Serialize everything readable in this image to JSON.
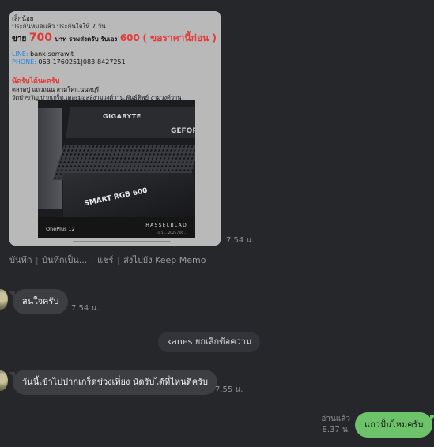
{
  "image_message": {
    "ad_lines": {
      "line1": "เล็กน้อย",
      "line2": "ประกันหมดแล้ว ประกันใจให้ 7 วัน",
      "price_prefix": "ขาย",
      "price_main": "700",
      "price_mid": "บาท รวมส่งครับ รับเอง",
      "price_pickup": "600",
      "price_note": "( ขอราคานี้ก่อน )",
      "line_label": "LINE:",
      "line_value": "bank-sorrawit",
      "phone_label": "PHONE:",
      "phone_value": "063-1760251|083-8427251",
      "meet_title": "นัดรับได้นะครับ",
      "address1": "ตลาดบู่ แถวถนน สามโคก,นนทบุรี",
      "address2": "วัดบัวขวัญ,ปากเกร็ด,เดอะมอลล์งามวงศ์วาน,พันธุ์ทิพย์ งามวงศ์วาน"
    },
    "photo": {
      "gpu_brand": "GIGABYTE",
      "gpu_brand2": "GEFOR",
      "psu_label": "SMART RGB 600",
      "watermark_device": "OnePlus 12",
      "watermark_brand": "HASSELBLAD",
      "watermark_sub": "⊙ 5 ... 2025 / 06 ..."
    },
    "time": "7.54 น."
  },
  "actions": {
    "save": "บันทึก",
    "save_as": "บันทึกเป็น...",
    "share": "แชร์",
    "keep": "ส่งไปยัง Keep Memo"
  },
  "messages": [
    {
      "from": "other",
      "text": "สนใจครับ",
      "time": "7.54 น."
    },
    {
      "from": "system",
      "text": "kanes ยกเลิกข้อความ"
    },
    {
      "from": "other",
      "text": "วันนี้เข้าไปปากเกร็ดช่วงเที่ยง นัดรับได้ที่ไหนดีครับ",
      "time": "7.55 น."
    },
    {
      "from": "me",
      "text": "แถวปั้มไหมครับ",
      "read": "อ่านแล้ว",
      "time": "8.37 น."
    }
  ],
  "colors": {
    "background": "#26272b",
    "bubble_other": "#3d3e42",
    "bubble_mine": "#6cc36a",
    "price_red": "#e53935"
  }
}
